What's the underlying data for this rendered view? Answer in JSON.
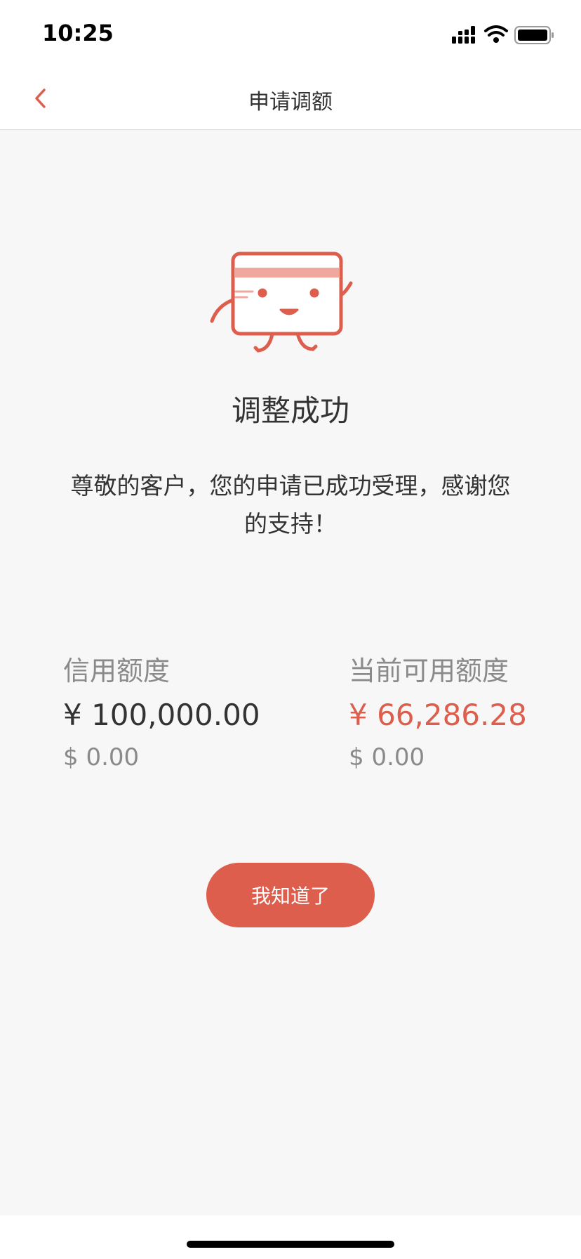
{
  "status_bar": {
    "time": "10:25",
    "icons": [
      "signal-icon",
      "wifi-icon",
      "battery-icon"
    ]
  },
  "nav": {
    "title": "申请调额",
    "back_icon": "chevron-left-icon"
  },
  "result": {
    "title": "调整成功",
    "message": "尊敬的客户，您的申请已成功受理，感谢您的支持！"
  },
  "limits": {
    "credit": {
      "label": "信用额度",
      "cny": "¥ 100,000.00",
      "usd": "$ 0.00"
    },
    "available": {
      "label": "当前可用额度",
      "cny": "¥ 66,286.28",
      "usd": "$ 0.00"
    }
  },
  "actions": {
    "ok_label": "我知道了"
  },
  "colors": {
    "accent": "#dd5e4c",
    "accent_light": "#f0a89d",
    "background": "#f7f7f7",
    "text_primary": "#333333",
    "text_secondary": "#8a8a8a"
  }
}
